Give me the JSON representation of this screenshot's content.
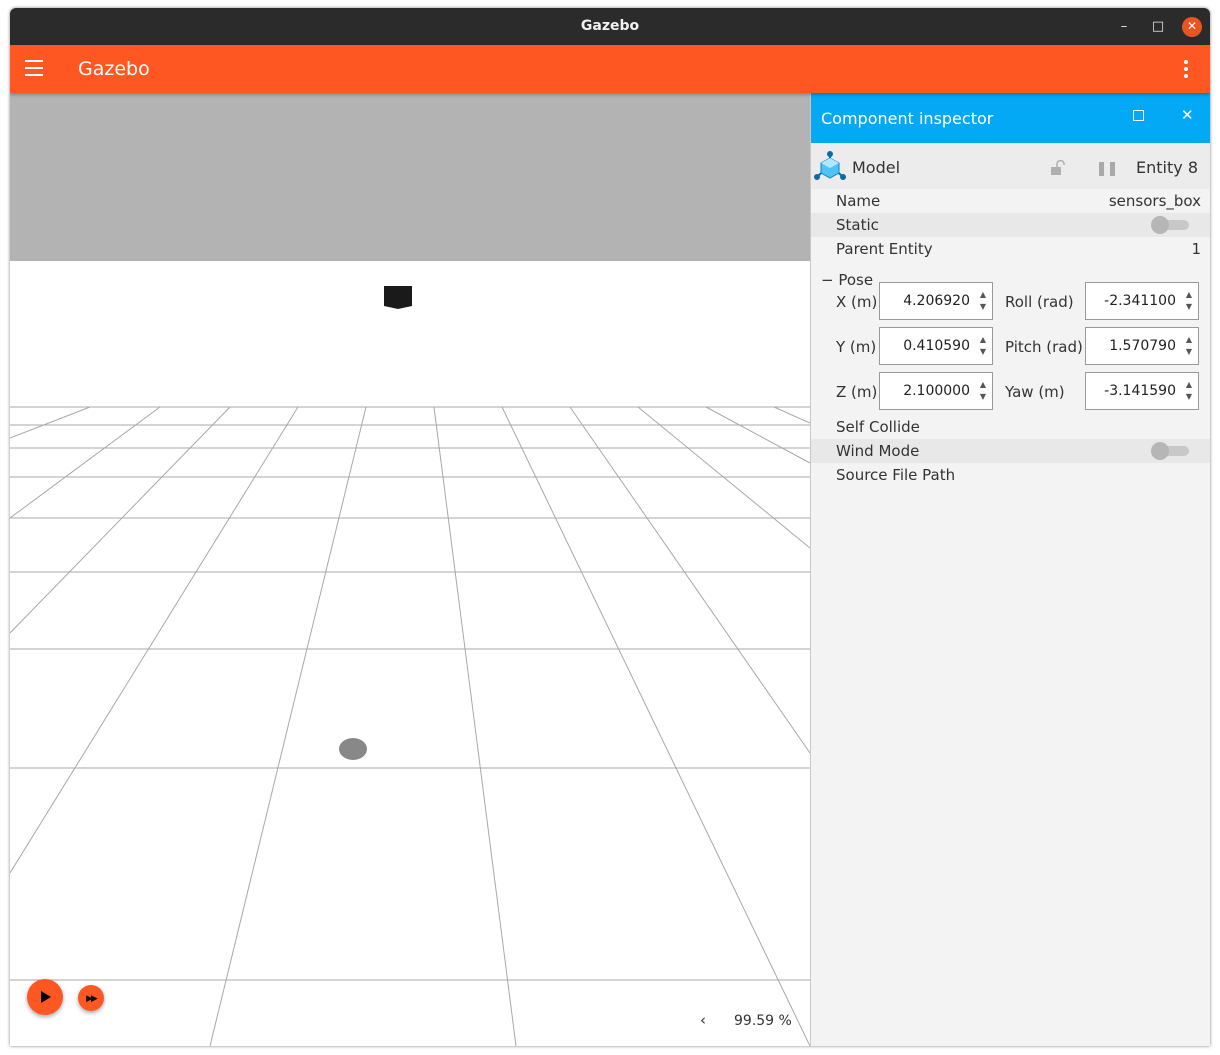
{
  "window": {
    "title": "Gazebo",
    "minimize": "–",
    "maximize": "□",
    "close": "✕"
  },
  "appbar": {
    "title": "Gazebo"
  },
  "scene": {
    "play_icon": "play-icon",
    "step_icon": "fast-forward-icon",
    "rtf_arrow": "‹",
    "real_time_factor": "99.59 %"
  },
  "inspector": {
    "title": "Component inspector",
    "maximize": "□",
    "close": "✕",
    "model_type": "Model",
    "entity": "Entity 8",
    "rows": {
      "name_label": "Name",
      "name_value": "sensors_box",
      "static_label": "Static",
      "static_on": false,
      "parent_label": "Parent Entity",
      "parent_value": "1",
      "self_collide_label": "Self Collide",
      "wind_mode_label": "Wind Mode",
      "wind_mode_on": false,
      "source_path_label": "Source File Path"
    },
    "pose": {
      "toggle": "−",
      "label": "Pose",
      "x_label": "X (m)",
      "x": "4.206920",
      "y_label": "Y (m)",
      "y": "0.410590",
      "z_label": "Z (m)",
      "z": "2.100000",
      "roll_label": "Roll (rad)",
      "roll": "-2.341100",
      "pitch_label": "Pitch (rad)",
      "pitch": "1.570790",
      "yaw_label": "Yaw (m)",
      "yaw": "-3.141590"
    }
  },
  "colors": {
    "appbar": "#ff5722",
    "inspector_header": "#03a9f4",
    "titlebar": "#2b2b2b",
    "close_button": "#e95420"
  }
}
